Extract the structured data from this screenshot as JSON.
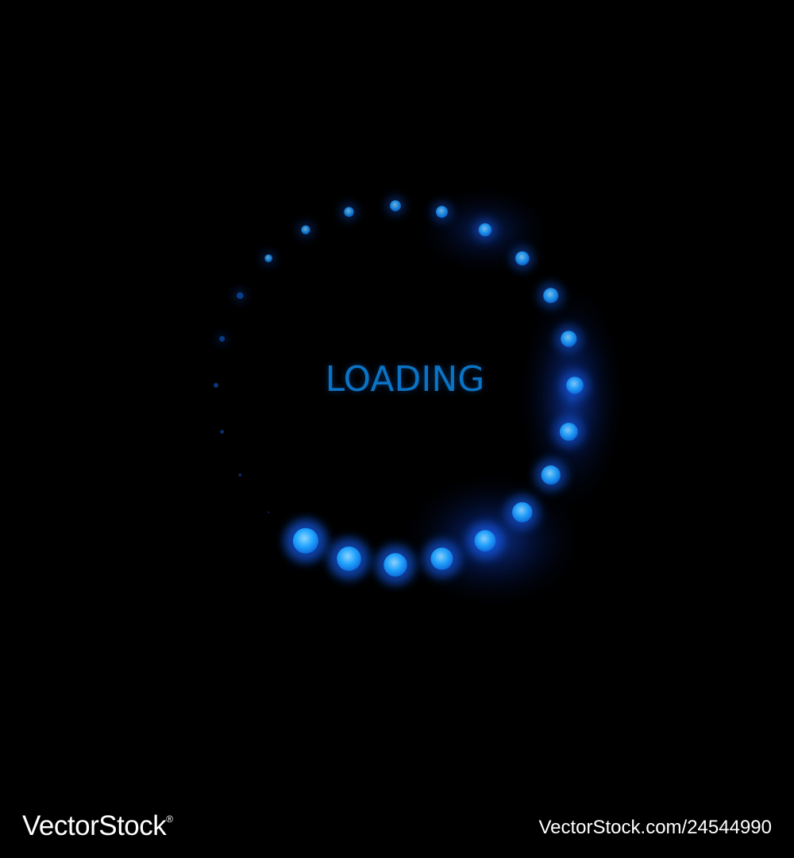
{
  "loader": {
    "label": "LOADING",
    "dot_count": 24,
    "head_color": "#1fa4ff",
    "tail_color": "#0a4fae",
    "glow_color": "#1565ff",
    "text_color": "#0a73c4",
    "direction": "clockwise",
    "background": "#000000"
  },
  "footer": {
    "brand": "VectorStock",
    "brand_mark": "®",
    "image_id": "VectorStock.com/24544990"
  }
}
